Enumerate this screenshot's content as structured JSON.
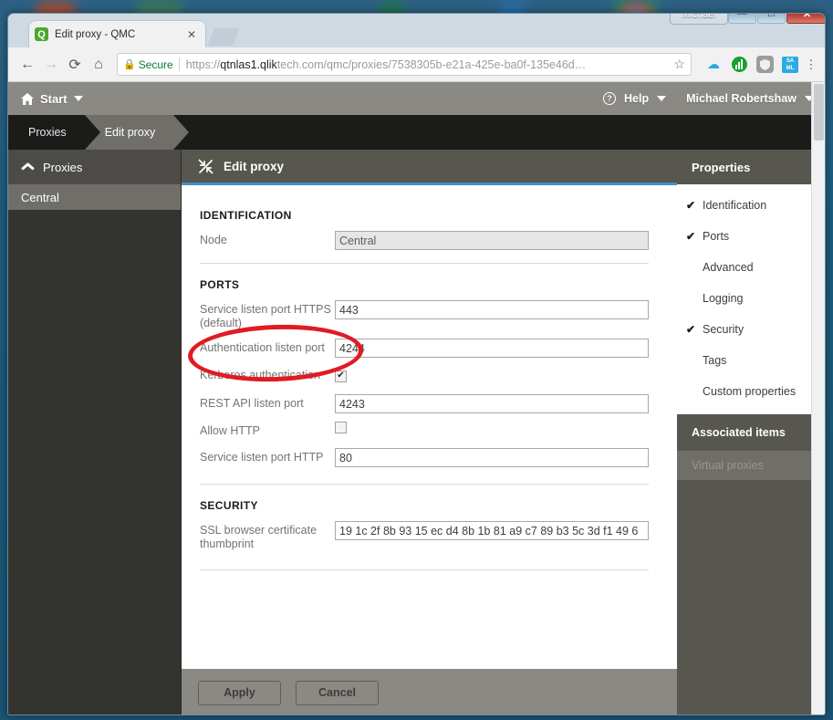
{
  "desktop": {
    "background_color": "#1d5c7e"
  },
  "window": {
    "user_label": "Michael",
    "minimize": "—",
    "maximize": "□",
    "close": "✕"
  },
  "browser": {
    "tab": {
      "title": "Edit proxy - QMC",
      "favicon_name": "qlik-favicon",
      "favicon_letter": "Q",
      "close_label": "✕"
    },
    "new_tab_name": "new-tab-button",
    "nav": {
      "back": "←",
      "forward": "→",
      "reload": "⟳",
      "home": "⌂"
    },
    "omnibox": {
      "lock_icon": "lock-icon",
      "secure_label": "Secure",
      "url_bold": "qtnlas1.qlik",
      "url_prefix": "https://",
      "url_suffix": "tech.com/qmc/proxies/7538305b-e21a-425e-ba0f-135e46d…",
      "bookmark_icon": "star-icon"
    },
    "extensions": [
      {
        "name": "cloud-extension-icon",
        "glyph": "☁",
        "color": "#27a9e0"
      },
      {
        "name": "analytics-extension-icon",
        "glyph": "",
        "color": "#17a02f"
      },
      {
        "name": "shield-extension-icon",
        "glyph": "⬢",
        "color": "#9c9c9c"
      },
      {
        "name": "saml-extension-icon",
        "glyph": "SAML",
        "color": "#29abe2"
      }
    ],
    "menu_icon": "kebab-menu-icon"
  },
  "qmc": {
    "topbar": {
      "start_label": "Start",
      "help_label": "Help",
      "help_icon_glyph": "?",
      "user_label": "Michael Robertshaw"
    },
    "breadcrumbs": [
      {
        "label": "Proxies",
        "active": false
      },
      {
        "label": "Edit proxy",
        "active": true
      }
    ],
    "leftnav": {
      "header": "Proxies",
      "items": [
        {
          "label": "Central",
          "selected": true
        }
      ]
    },
    "content_header": {
      "title": "Edit proxy",
      "icon_name": "collapse-arrows-icon",
      "accent_color": "#3f92c6"
    },
    "sections": [
      {
        "title": "IDENTIFICATION",
        "fields": [
          {
            "label": "Node",
            "type": "text",
            "value": "Central",
            "disabled": true,
            "name": "node-field"
          }
        ]
      },
      {
        "title": "PORTS",
        "fields": [
          {
            "label": "Service listen port HTTPS (default)",
            "type": "text",
            "value": "443",
            "disabled": false,
            "name": "service-listen-port-https-field"
          },
          {
            "label": "Authentication listen port",
            "type": "text",
            "value": "4244",
            "disabled": false,
            "name": "authentication-listen-port-field"
          },
          {
            "label": "Kerberos authentication",
            "type": "checkbox",
            "checked": true,
            "name": "kerberos-authentication-checkbox"
          },
          {
            "label": "REST API listen port",
            "type": "text",
            "value": "4243",
            "disabled": false,
            "name": "rest-api-listen-port-field"
          },
          {
            "label": "Allow HTTP",
            "type": "checkbox",
            "checked": false,
            "name": "allow-http-checkbox"
          },
          {
            "label": "Service listen port HTTP",
            "type": "text",
            "value": "80",
            "disabled": false,
            "name": "service-listen-port-http-field"
          }
        ]
      },
      {
        "title": "SECURITY",
        "fields": [
          {
            "label": "SSL browser certificate thumbprint",
            "type": "text",
            "value": "19 1c 2f 8b 93 15 ec d4 8b 1b 81 a9 c7 89 b3 5c 3d f1 49 6",
            "disabled": false,
            "name": "ssl-browser-certificate-thumbprint-field"
          }
        ]
      }
    ],
    "footer": {
      "apply_label": "Apply",
      "cancel_label": "Cancel"
    },
    "properties": {
      "title": "Properties",
      "items": [
        {
          "label": "Identification",
          "checked": true
        },
        {
          "label": "Ports",
          "checked": true
        },
        {
          "label": "Advanced",
          "checked": false
        },
        {
          "label": "Logging",
          "checked": false
        },
        {
          "label": "Security",
          "checked": true
        },
        {
          "label": "Tags",
          "checked": false
        },
        {
          "label": "Custom properties",
          "checked": false
        }
      ],
      "check_glyph": "✔",
      "associated_title": "Associated items",
      "associated_items": [
        {
          "label": "Virtual proxies"
        }
      ]
    }
  },
  "annotation": {
    "shape": "ellipse",
    "color": "#e01b22"
  }
}
